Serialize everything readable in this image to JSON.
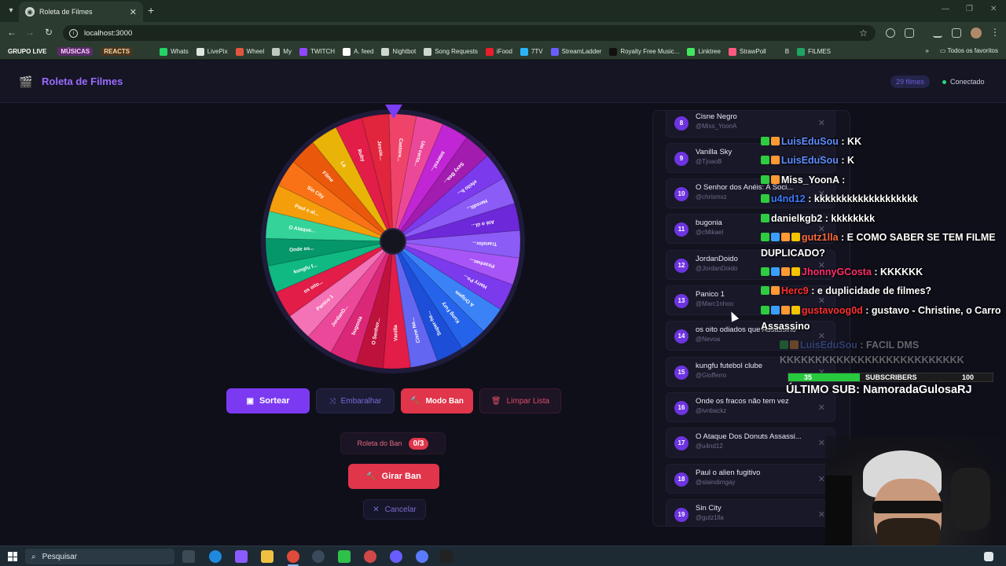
{
  "browser": {
    "tab_title": "Roleta de Filmes",
    "url": "localhost:3000",
    "bookmarks": [
      {
        "label": "GRUPO LIVE",
        "color": "#2b3b2f",
        "tag": true,
        "text_color": "#ffffff"
      },
      {
        "label": "MÚSICAS",
        "color": "#5a2b6b",
        "tag": true,
        "text_color": "#ffd0ff"
      },
      {
        "label": "REACTS",
        "color": "#4a3520",
        "tag": true,
        "text_color": "#ffd9a0"
      },
      {
        "label": "",
        "color": "#2b3b2f",
        "icon": "grid-icon"
      },
      {
        "label": "Whats",
        "color": "#25d366",
        "icon": "whatsapp-icon"
      },
      {
        "label": "LivePix",
        "color": "#dfe6df",
        "icon": "livepix-icon"
      },
      {
        "label": "Wheel",
        "color": "#e2553d",
        "icon": "wheel-icon"
      },
      {
        "label": "My",
        "color": "#bfc9bf",
        "icon": "my-icon"
      },
      {
        "label": "TWITCH",
        "color": "#9146ff",
        "icon": "twitch-icon"
      },
      {
        "label": "A. feed",
        "color": "#ffffff",
        "icon": "feed-icon"
      },
      {
        "label": "Nightbot",
        "color": "#cfd8cf",
        "icon": "nightbot-icon"
      },
      {
        "label": "Song Requests",
        "color": "#cfd8cf",
        "icon": "song-icon"
      },
      {
        "label": "iFood",
        "color": "#ea1d2c",
        "icon": "ifood-icon"
      },
      {
        "label": "7TV",
        "color": "#29b6f6",
        "icon": "7tv-icon"
      },
      {
        "label": "StreamLadder",
        "color": "#6b5cff",
        "icon": "streamladder-icon"
      },
      {
        "label": "Royalty Free Music...",
        "color": "#111111",
        "icon": "music-icon"
      },
      {
        "label": "Linktree",
        "color": "#43e660",
        "icon": "linktree-icon"
      },
      {
        "label": "StrawPoll",
        "color": "#ff5b7f",
        "icon": "strawpoll-icon"
      },
      {
        "label": "B",
        "color": "#2b3b2f",
        "icon": "b-icon"
      },
      {
        "label": "FILMES",
        "color": "#1fa463",
        "icon": "sheets-icon"
      }
    ],
    "all_bookmarks": "Todos os favoritos"
  },
  "app": {
    "title": "Roleta de Filmes",
    "film_count": "29 filmes",
    "connection": "Conectado"
  },
  "wheel": {
    "labels": [
      "Jessie...",
      "Castore...",
      "Um certo...",
      "Interesl...",
      "Sexy Bea...",
      "efeito b...",
      "Heredit...",
      "Até o úl...",
      "Transfor...",
      "Piranhac...",
      "Harry Po...",
      "A Origem",
      "Kung Fury",
      "Super-he...",
      "Cisne Ne...",
      "Vanilla",
      "O Senhor...",
      "bugonia",
      "JordanD...",
      "Panico 1",
      "os oito...",
      "kungfu f...",
      "Onde os...",
      "O Ataque...",
      "Paul o al...",
      "Sin City",
      "Filme",
      "La",
      "Ruby"
    ],
    "colors": [
      "#e0253c",
      "#f0436a",
      "#ec4899",
      "#c026d3",
      "#a21caf",
      "#7c3aed",
      "#8b5cf6",
      "#6d28d9",
      "#8b5cf6",
      "#a855f7",
      "#7c3aed",
      "#3b82f6",
      "#2563eb",
      "#1d4ed8",
      "#6366f1",
      "#e11d48",
      "#be123c",
      "#db2777",
      "#ec4899",
      "#f472b6",
      "#e11d48",
      "#10b981",
      "#059669",
      "#34d399",
      "#f59e0b",
      "#f97316",
      "#ea580c",
      "#eab308",
      "#e11d48"
    ]
  },
  "controls": {
    "sortear": "Sortear",
    "embaralhar": "Embaralhar",
    "modo_ban": "Modo Ban",
    "limpar_lista": "Limpar Lista",
    "roleta_ban": "Roleta do Ban",
    "ban_count": "0/3",
    "girar_ban": "Girar Ban",
    "cancelar": "Cancelar"
  },
  "films": [
    {
      "n": "8",
      "title": "Cisne Negro",
      "user": "@Miss_YoonA"
    },
    {
      "n": "9",
      "title": "Vanilla Sky",
      "user": "@TjoaoB"
    },
    {
      "n": "10",
      "title": "O Senhor dos Anéis: A Soci...",
      "user": "@chrismxz"
    },
    {
      "n": "11",
      "title": "bugonia",
      "user": "@cMikael"
    },
    {
      "n": "12",
      "title": "JordanDoido",
      "user": "@JordanDoido"
    },
    {
      "n": "13",
      "title": "Panico 1",
      "user": "@Marc1nhoo"
    },
    {
      "n": "14",
      "title": "os oito odiados que Assassino",
      "user": "@Nevoa"
    },
    {
      "n": "15",
      "title": "kungfu futebol clube",
      "user": "@Giofferro"
    },
    {
      "n": "16",
      "title": "Onde os fracos não tem vez",
      "user": "@ivnbackz"
    },
    {
      "n": "17",
      "title": "O Ataque Dos Donuts Assassi...",
      "user": "@u4nd12"
    },
    {
      "n": "18",
      "title": "Paul o alien fugitivo",
      "user": "@slaindimgay"
    },
    {
      "n": "19",
      "title": "Sin City",
      "user": "@gutz1lla"
    }
  ],
  "chat": [
    {
      "user": "LuisEduSou",
      "color": "#5f8dff",
      "msg": ": KK"
    },
    {
      "user": "LuisEduSou",
      "color": "#5f8dff",
      "msg": ": K"
    },
    {
      "user": "Miss_YoonA",
      "color": "#ffffff",
      "msg": ":"
    },
    {
      "user": "u4nd12",
      "color": "#3d7bff",
      "msg": ": kkkkkkkkkkkkkkkkkkk"
    },
    {
      "user": "danielkgb2",
      "color": "#ffffff",
      "msg": ": kkkkkkkk"
    },
    {
      "user": "gutz1lla",
      "color": "#ff6a3d",
      "msg": ": E COMO SABER SE TEM FILME"
    },
    {
      "user": "",
      "color": "#ffffff",
      "msg": "DUPLICADO?"
    },
    {
      "user": "JhonnyGCosta",
      "color": "#ff2d6a",
      "msg": ": KKKKKK"
    },
    {
      "user": "Herc9",
      "color": "#ff2d2d",
      "msg": ": e duplicidade de filmes?"
    },
    {
      "user": "gustavoog0d",
      "color": "#ff3030",
      "msg": ": gustavo - Christine, o Carro"
    },
    {
      "user": "",
      "color": "#ffffff",
      "msg": "Assassino"
    },
    {
      "user": "LuisEduSou",
      "color": "#5f8dff",
      "msg": ": FACIL DMS"
    },
    {
      "user": "",
      "color": "#ffffff",
      "msg": "KKKKKKKKKKKKKKKKKKKKKKKKKK"
    }
  ],
  "subs": {
    "current": "35",
    "label": "SUBSCRIBERS",
    "goal": "100",
    "progress": 0.35
  },
  "last_sub": "ÚLTIMO SUB: NamoradaGulosaRJ",
  "taskbar": {
    "search_label": "Pesquisar"
  }
}
